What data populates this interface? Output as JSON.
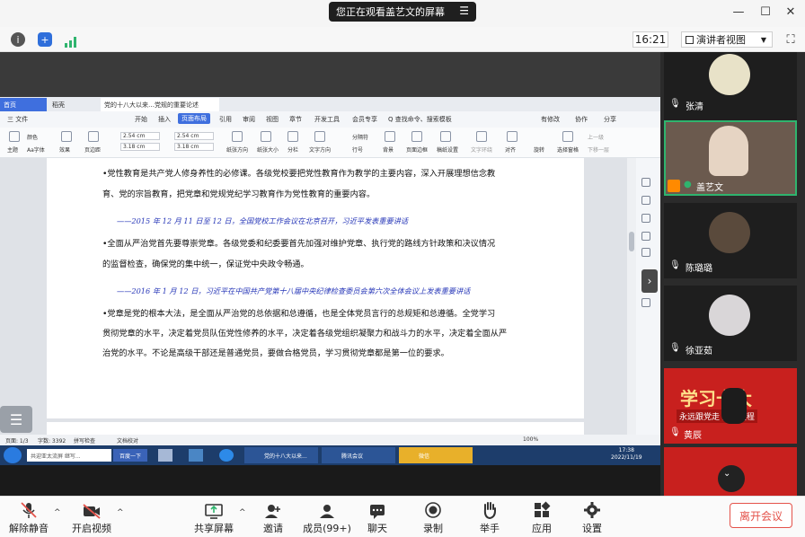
{
  "banner": {
    "text": "您正在观看盖艺文的屏幕"
  },
  "info": {
    "time": "16:21",
    "view_label": "演讲者视图"
  },
  "wps": {
    "tabs": [
      "首页",
      "稻壳",
      "党的十八大以来…党规的重要论述"
    ],
    "menu": [
      "三 文件",
      "开始",
      "插入",
      "页面布局",
      "引用",
      "审阅",
      "视图",
      "章节",
      "开发工具",
      "会员专享",
      "Q 查找命令、搜索模板",
      "有修改",
      "协作",
      "分享"
    ],
    "active_menu": "页面布局",
    "ribbon_labels": [
      "主题",
      "颜色",
      "效果",
      "页边距",
      "纸张方向",
      "纸张大小",
      "分栏",
      "文字方向",
      "行号",
      "背景",
      "页面边框",
      "稿纸设置",
      "文字环绕",
      "对齐",
      "旋转",
      "选择窗格"
    ],
    "ribbon_small": [
      "Aa字体",
      "分隔符",
      "上一级",
      "下移一层"
    ],
    "margins": {
      "top": "2.54 cm",
      "bottom": "2.54 cm",
      "left": "3.18 cm",
      "right": "3.18 cm"
    },
    "paragraphs": [
      "•党性教育是共产党人修身养性的必修课。各级党校要把党性教育作为教学的主要内容，深入开展理想信念教",
      "育、党的宗旨教育，把党章和党规党纪学习教育作为党性教育的重要内容。",
      "——2015 年 12 月 11 日至 12 日，全国党校工作会议在北京召开，习近平发表重要讲话",
      "•全面从严治党首先要尊崇党章。各级党委和纪委要首先加强对维护党章、执行党的路线方针政策和决议情况",
      "的监督检查，确保党的集中统一，保证党中央政令畅通。",
      "——2016 年 1 月 12 日，习近平在中国共产党第十八届中央纪律检查委员会第六次全体会议上发表重要讲话",
      "•党章是党的根本大法，是全面从严治党的总依据和总遵循，也是全体党员言行的总规矩和总遵循。全党学习",
      "贯彻党章的水平，决定着党员队伍党性修养的水平，决定着各级党组织凝聚力和战斗力的水平，决定着全面从严",
      "治党的水平。不论是高级干部还是普通党员，要做合格党员，学习贯彻党章都是第一位的要求。"
    ],
    "status": {
      "page": "页面: 1/3",
      "words": "字数: 3392",
      "spell": "拼写检查",
      "check": "文档校对",
      "zoom": "100%"
    },
    "taskbar": {
      "search": "共迎亚太流屏 继写...",
      "baidu": "百度一下",
      "apps": [
        "党的十八大以来...",
        "腾讯会议",
        "微信"
      ],
      "clock_time": "17:38",
      "clock_date": "2022/11/19"
    }
  },
  "participants": [
    {
      "name": "张清"
    },
    {
      "name": "盖艺文"
    },
    {
      "name": "陈璐璐"
    },
    {
      "name": "徐亚茹"
    },
    {
      "name": "黄辰"
    },
    {
      "name": ""
    }
  ],
  "banner_slogan": {
    "line1": "学习十大",
    "line2": "永远跟党走 进新征程"
  },
  "toolbar": {
    "unmute": "解除静音",
    "video": "开启视频",
    "share": "共享屏幕",
    "invite": "邀请",
    "members": "成员(99+)",
    "chat": "聊天",
    "record": "录制",
    "raise": "举手",
    "apps": "应用",
    "settings": "设置",
    "leave": "离开会议"
  },
  "colors": {
    "accent_blue": "#3f6fde",
    "active_green": "#2fb46e",
    "leave_red": "#e4524a",
    "quote_blue": "#2737b8"
  }
}
